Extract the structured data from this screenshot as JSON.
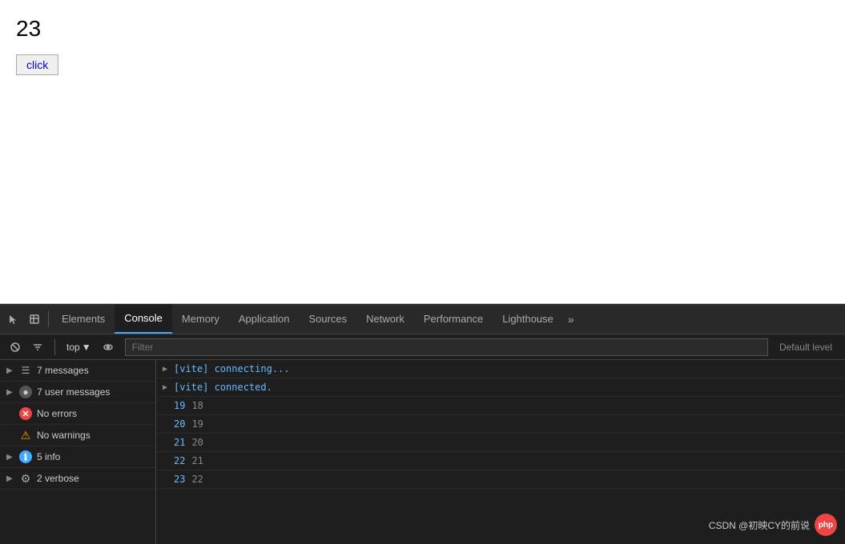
{
  "page": {
    "number": "23",
    "click_button": "click"
  },
  "devtools": {
    "tabs": [
      {
        "label": "Elements",
        "active": false
      },
      {
        "label": "Console",
        "active": true
      },
      {
        "label": "Memory",
        "active": false
      },
      {
        "label": "Application",
        "active": false
      },
      {
        "label": "Sources",
        "active": false
      },
      {
        "label": "Network",
        "active": false
      },
      {
        "label": "Performance",
        "active": false
      },
      {
        "label": "Lighthouse",
        "active": false
      }
    ],
    "toolbar": {
      "top_label": "top",
      "filter_placeholder": "Filter",
      "default_level": "Default level"
    },
    "sidebar": {
      "items": [
        {
          "label": "7 messages",
          "icon": "list",
          "has_arrow": true
        },
        {
          "label": "7 user messages",
          "icon": "user",
          "has_arrow": true
        },
        {
          "label": "No errors",
          "icon": "error",
          "has_arrow": false
        },
        {
          "label": "No warnings",
          "icon": "warning",
          "has_arrow": false
        },
        {
          "label": "5 info",
          "icon": "info",
          "has_arrow": true
        },
        {
          "label": "2 verbose",
          "icon": "verbose",
          "has_arrow": true
        }
      ]
    },
    "messages": [
      {
        "type": "blue",
        "text": "[vite] connecting..."
      },
      {
        "type": "blue",
        "text": "[vite] connected."
      },
      {
        "type": "pair",
        "a": "19",
        "b": "18"
      },
      {
        "type": "pair",
        "a": "20",
        "b": "19"
      },
      {
        "type": "pair",
        "a": "21",
        "b": "20"
      },
      {
        "type": "pair",
        "a": "22",
        "b": "21"
      },
      {
        "type": "pair",
        "a": "23",
        "b": "22"
      }
    ]
  },
  "watermark": {
    "text": "CSDN @初映CY的前说",
    "logo": "php"
  }
}
